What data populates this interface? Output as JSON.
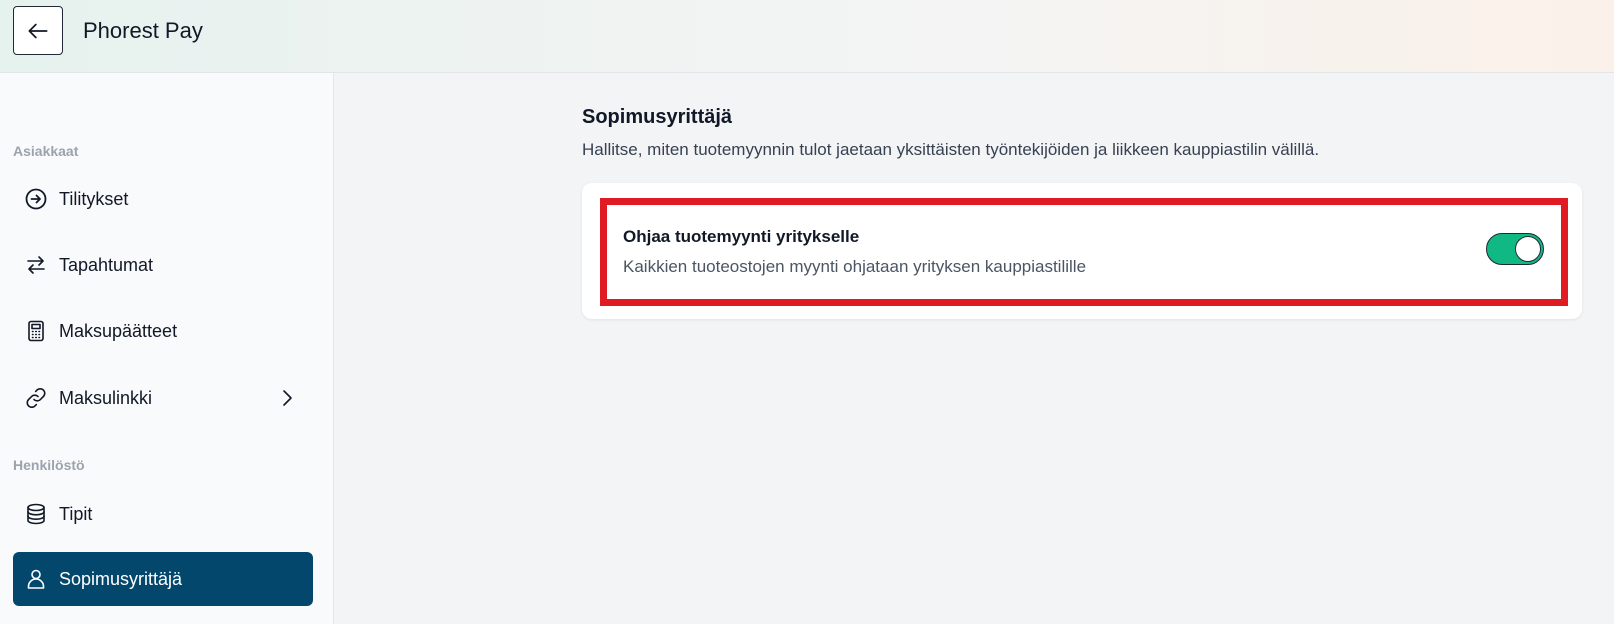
{
  "header": {
    "back_icon": "arrow-left-icon",
    "title": "Phorest Pay"
  },
  "sidebar": {
    "sections": [
      {
        "label": "Asiakkaat",
        "items": [
          {
            "label": "Tilitykset",
            "icon": "arrow-circle-right-icon"
          },
          {
            "label": "Tapahtumat",
            "icon": "arrows-swap-icon"
          },
          {
            "label": "Maksupäätteet",
            "icon": "calculator-icon"
          },
          {
            "label": "Maksulinkki",
            "icon": "link-icon",
            "has_submenu": true
          }
        ]
      },
      {
        "label": "Henkilöstö",
        "items": [
          {
            "label": "Tipit",
            "icon": "database-icon"
          },
          {
            "label": "Sopimusyrittäjä",
            "icon": "user-icon",
            "active": true
          }
        ]
      }
    ]
  },
  "main": {
    "title": "Sopimusyrittäjä",
    "description": "Hallitse, miten tuotemyynnin tulot jaetaan yksittäisten työntekijöiden ja liikkeen kauppiastilin välillä.",
    "setting": {
      "title": "Ohjaa tuotemyynti yritykselle",
      "description": "Kaikkien tuoteostojen myynti ohjataan yrityksen kauppiastilille",
      "enabled": true
    }
  },
  "colors": {
    "active_nav": "#03476c",
    "toggle_on": "#10b981",
    "highlight": "#e01b24"
  }
}
